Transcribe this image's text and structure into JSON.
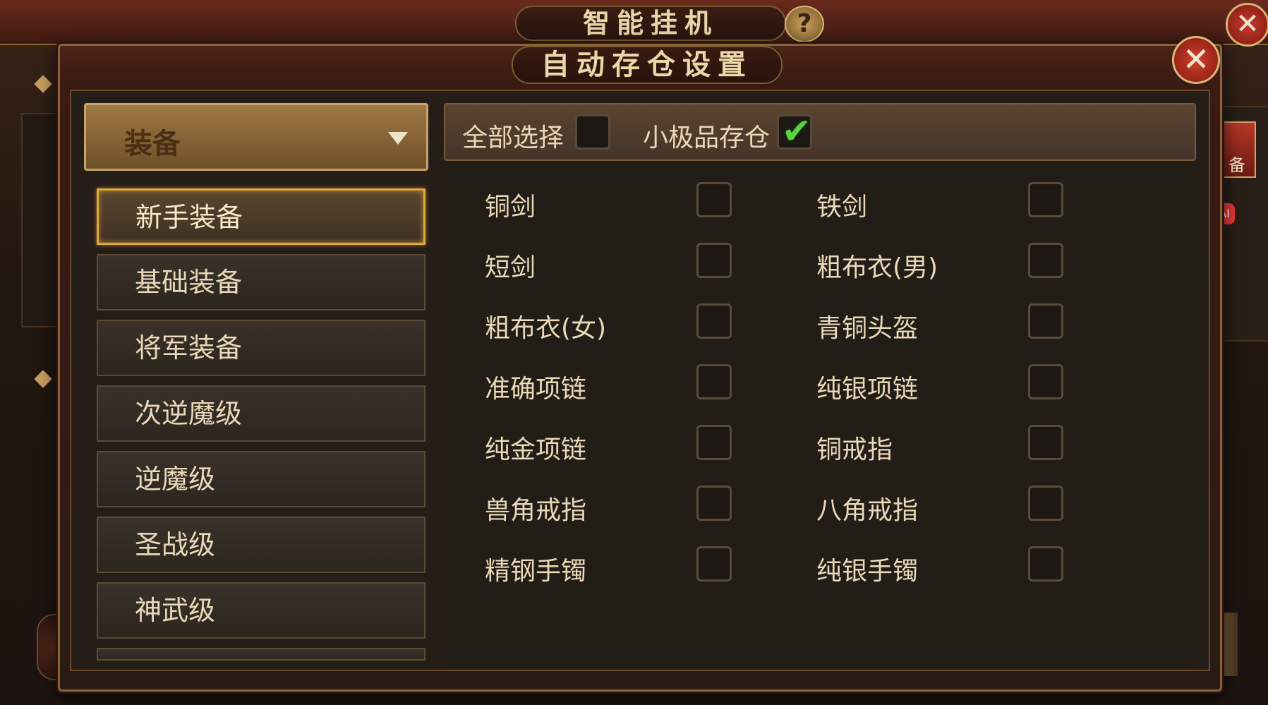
{
  "background_window": {
    "title": "智能挂机",
    "help_icon": "?",
    "close_icon": "✕",
    "right_badge": "备",
    "red_dot": "AI"
  },
  "modal": {
    "title": "自动存仓设置",
    "close_icon": "✕"
  },
  "category_dropdown": {
    "selected": "装备"
  },
  "categories": [
    {
      "label": "新手装备",
      "active": true
    },
    {
      "label": "基础装备",
      "active": false
    },
    {
      "label": "将军装备",
      "active": false
    },
    {
      "label": "次逆魔级",
      "active": false
    },
    {
      "label": "逆魔级",
      "active": false
    },
    {
      "label": "圣战级",
      "active": false
    },
    {
      "label": "神武级",
      "active": false
    }
  ],
  "options": {
    "select_all_label": "全部选择",
    "select_all_checked": false,
    "minor_item_label": "小极品存仓",
    "minor_item_checked": true
  },
  "items": [
    {
      "left": "铜剑",
      "right": "铁剑"
    },
    {
      "left": "短剑",
      "right": "粗布衣(男)"
    },
    {
      "left": "粗布衣(女)",
      "right": "青铜头盔"
    },
    {
      "left": "准确项链",
      "right": "纯银项链"
    },
    {
      "left": "纯金项链",
      "right": "铜戒指"
    },
    {
      "left": "兽角戒指",
      "right": "八角戒指"
    },
    {
      "left": "精钢手镯",
      "right": "纯银手镯"
    }
  ]
}
